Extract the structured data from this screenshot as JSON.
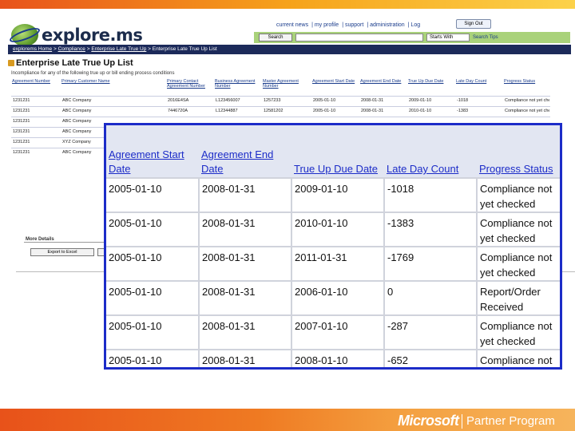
{
  "app": {
    "logo_text": "explore.ms",
    "top_links": [
      "current news",
      "my profile",
      "support",
      "administration",
      "Log"
    ],
    "signout_label": "Sign Out"
  },
  "search": {
    "button_label": "Search",
    "mode": "Starts With",
    "tips_label": "Search Tips"
  },
  "breadcrumb": {
    "items": [
      "explorems Home",
      "Compliance",
      "Enterprise Late True Up",
      "Enterprise Late True Up List"
    ]
  },
  "page": {
    "title": "Enterprise Late True Up List",
    "intro": "Incompliance for any of the following true up or bill ending process conditions"
  },
  "background_table": {
    "headers": [
      "Agreement Number",
      "Primary Customer Name",
      "Primary Contact Agreement Number",
      "Business Agreement Number",
      "Master Agreement Number",
      "Agreement Start Date",
      "Agreement End Date",
      "True Up Due Date",
      "Late Day Count",
      "Progress Status"
    ],
    "rows": [
      [
        "1231231",
        "ABC Company",
        "2016E4SA",
        "L123456007",
        "1257233",
        "2005-01-10",
        "2008-01-31",
        "2009-01-10",
        "-1018",
        "Compliance not yet checked"
      ],
      [
        "1231231",
        "ABC Company",
        "7446720A",
        "L12344887",
        "12581202",
        "2005-01-10",
        "2008-01-31",
        "2010-01-10",
        "-1383",
        "Compliance not yet checked"
      ],
      [
        "1231231",
        "ABC Company",
        "",
        "",
        "",
        "",
        "",
        "",
        "",
        ""
      ],
      [
        "1231231",
        "ABC Company",
        "",
        "",
        "",
        "",
        "",
        "",
        "",
        ""
      ],
      [
        "1231231",
        "XYZ Company",
        "",
        "",
        "",
        "",
        "",
        "",
        "",
        ""
      ],
      [
        "1231231",
        "ABC Company",
        "",
        "",
        "",
        "",
        "",
        "",
        "",
        ""
      ]
    ]
  },
  "more_details": {
    "label": "More Details",
    "button_label": "Export to Excel"
  },
  "zoom_table": {
    "headers": [
      "Agreement Start Date",
      "Agreement End Date",
      "True Up Due Date",
      "Late Day Count",
      "Progress Status"
    ],
    "rows": [
      [
        "2005-01-10",
        "2008-01-31",
        "2009-01-10",
        "-1018",
        "Compliance not yet checked"
      ],
      [
        "2005-01-10",
        "2008-01-31",
        "2010-01-10",
        "-1383",
        "Compliance not yet checked"
      ],
      [
        "2005-01-10",
        "2008-01-31",
        "2011-01-31",
        "-1769",
        "Compliance not yet checked"
      ],
      [
        "2005-01-10",
        "2008-01-31",
        "2006-01-10",
        "0",
        "Report/Order Received"
      ],
      [
        "2005-01-10",
        "2008-01-31",
        "2007-01-10",
        "-287",
        "Compliance not yet checked"
      ],
      [
        "2005-01-10",
        "2008-01-31",
        "2008-01-10",
        "-652",
        "Compliance not yet checked"
      ]
    ]
  },
  "footer": {
    "brand": "Microsoft",
    "program": "Partner Program"
  },
  "colors": {
    "accent_orange": "#e8521a",
    "highlight_border": "#1c2cc8",
    "link_blue": "#1a3c8c",
    "search_green": "#a9d27a",
    "nav_navy": "#1c2a5a"
  }
}
